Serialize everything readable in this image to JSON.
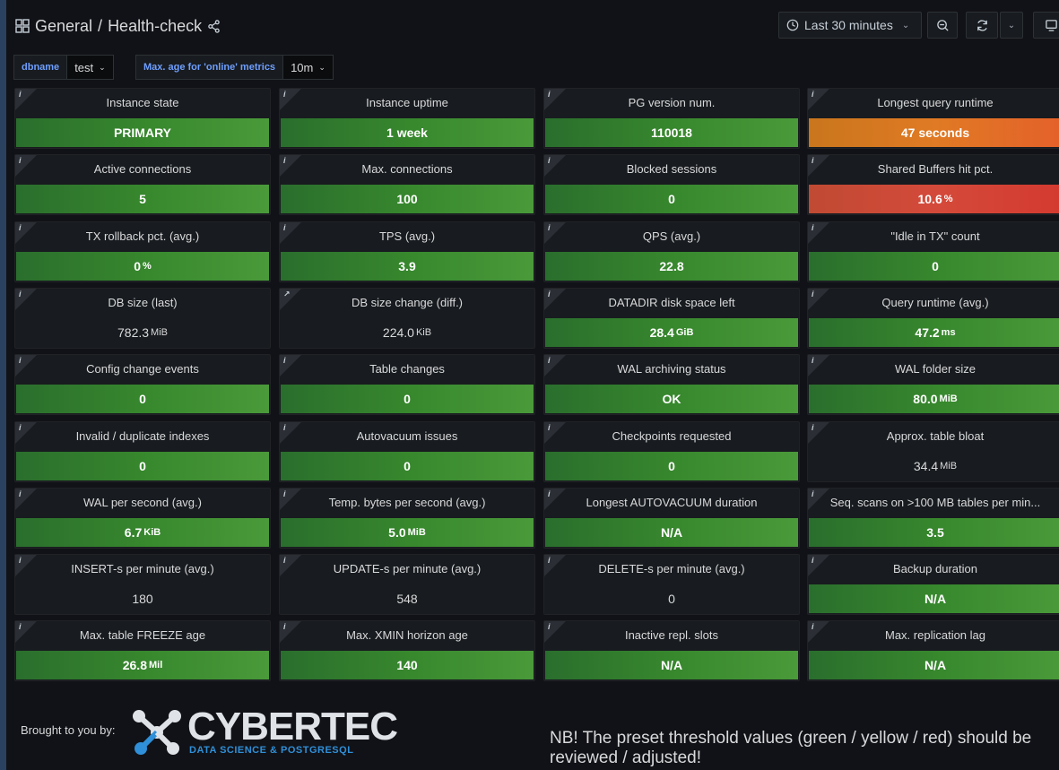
{
  "header": {
    "breadcrumb_folder": "General",
    "breadcrumb_sep": "/",
    "dashboard_title": "Health-check",
    "time_range": "Last 30 minutes"
  },
  "variables": [
    {
      "label": "dbname",
      "value": "test"
    },
    {
      "label": "Max. age for 'online' metrics",
      "value": "10m"
    }
  ],
  "panels": [
    {
      "title": "Instance state",
      "value": "PRIMARY",
      "unit": "",
      "color": "green"
    },
    {
      "title": "Instance uptime",
      "value": "1 week",
      "unit": "",
      "color": "green"
    },
    {
      "title": "PG version num.",
      "value": "110018",
      "unit": "",
      "color": "green"
    },
    {
      "title": "Longest query runtime",
      "value": "47 seconds",
      "unit": "",
      "color": "orange"
    },
    {
      "title": "Active connections",
      "value": "5",
      "unit": "",
      "color": "green"
    },
    {
      "title": "Max. connections",
      "value": "100",
      "unit": "",
      "color": "green"
    },
    {
      "title": "Blocked sessions",
      "value": "0",
      "unit": "",
      "color": "green"
    },
    {
      "title": "Shared Buffers hit pct.",
      "value": "10.6",
      "unit": "%",
      "color": "red"
    },
    {
      "title": "TX rollback pct. (avg.)",
      "value": "0",
      "unit": "%",
      "color": "green"
    },
    {
      "title": "TPS (avg.)",
      "value": "3.9",
      "unit": "",
      "color": "green"
    },
    {
      "title": "QPS (avg.)",
      "value": "22.8",
      "unit": "",
      "color": "green"
    },
    {
      "title": "\"Idle in TX\" count",
      "value": "0",
      "unit": "",
      "color": "green"
    },
    {
      "title": "DB size (last)",
      "value": "782.3",
      "unit": "MiB",
      "color": "none"
    },
    {
      "title": "DB size change (diff.)",
      "value": "224.0",
      "unit": "KiB",
      "color": "none"
    },
    {
      "title": "DATADIR disk space left",
      "value": "28.4",
      "unit": "GiB",
      "color": "green"
    },
    {
      "title": "Query runtime (avg.)",
      "value": "47.2",
      "unit": "ms",
      "color": "green"
    },
    {
      "title": "Config change events",
      "value": "0",
      "unit": "",
      "color": "green"
    },
    {
      "title": "Table changes",
      "value": "0",
      "unit": "",
      "color": "green"
    },
    {
      "title": "WAL archiving status",
      "value": "OK",
      "unit": "",
      "color": "green"
    },
    {
      "title": "WAL folder size",
      "value": "80.0",
      "unit": "MiB",
      "color": "green"
    },
    {
      "title": "Invalid / duplicate indexes",
      "value": "0",
      "unit": "",
      "color": "green"
    },
    {
      "title": "Autovacuum issues",
      "value": "0",
      "unit": "",
      "color": "green"
    },
    {
      "title": "Checkpoints requested",
      "value": "0",
      "unit": "",
      "color": "green"
    },
    {
      "title": "Approx. table bloat",
      "value": "34.4",
      "unit": "MiB",
      "color": "none"
    },
    {
      "title": "WAL per second (avg.)",
      "value": "6.7",
      "unit": "KiB",
      "color": "green"
    },
    {
      "title": "Temp. bytes per second (avg.)",
      "value": "5.0",
      "unit": "MiB",
      "color": "green"
    },
    {
      "title": "Longest AUTOVACUUM duration",
      "value": "N/A",
      "unit": "",
      "color": "green"
    },
    {
      "title": "Seq. scans on >100 MB tables per min...",
      "value": "3.5",
      "unit": "",
      "color": "green"
    },
    {
      "title": "INSERT-s per minute (avg.)",
      "value": "180",
      "unit": "",
      "color": "none"
    },
    {
      "title": "UPDATE-s per minute (avg.)",
      "value": "548",
      "unit": "",
      "color": "none"
    },
    {
      "title": "DELETE-s per minute (avg.)",
      "value": "0",
      "unit": "",
      "color": "none"
    },
    {
      "title": "Backup duration",
      "value": "N/A",
      "unit": "",
      "color": "green"
    },
    {
      "title": "Max. table FREEZE age",
      "value": "26.8",
      "unit": "Mil",
      "color": "green"
    },
    {
      "title": "Max. XMIN horizon age",
      "value": "140",
      "unit": "",
      "color": "green"
    },
    {
      "title": "Inactive repl. slots",
      "value": "N/A",
      "unit": "",
      "color": "green"
    },
    {
      "title": "Max. replication lag",
      "value": "N/A",
      "unit": "",
      "color": "green"
    }
  ],
  "panel_link_index": 13,
  "footer": {
    "brought_by": "Brought to you by:",
    "logo_name": "CYBERTEC",
    "logo_tagline": "DATA SCIENCE & POSTGRESQL",
    "note": "NB! The preset threshold values (green / yellow / red) should be reviewed / adjusted!"
  },
  "colors": {
    "green": "#37872d",
    "orange": "#e07a24",
    "red": "#d44a3a",
    "background": "#111217",
    "panel": "#181b1f"
  },
  "icons": [
    "dashboard-grid-icon",
    "share-icon",
    "clock-icon",
    "zoom-out-icon",
    "refresh-icon",
    "chevron-down-icon",
    "tv-mode-icon",
    "info-icon",
    "external-link-icon"
  ]
}
